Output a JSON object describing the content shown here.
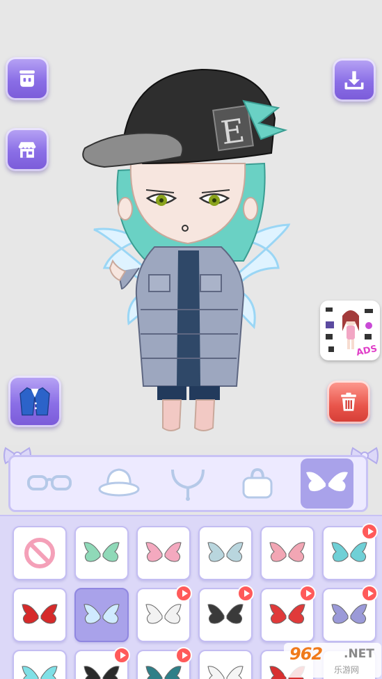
{
  "side_buttons": {
    "left": [
      {
        "name": "wardrobe-reset-button",
        "icon": "mannequin-icon"
      },
      {
        "name": "shop-button",
        "icon": "store-icon"
      },
      {
        "name": "outfit-button",
        "icon": "jacket-icon"
      }
    ],
    "right": [
      {
        "name": "download-button",
        "icon": "download-icon"
      },
      {
        "name": "delete-button",
        "icon": "trash-icon"
      }
    ]
  },
  "character": {
    "cap_letter": "E"
  },
  "ads_promo": {
    "label": "ADS"
  },
  "categories": [
    {
      "id": "glasses",
      "icon": "glasses-icon",
      "selected": false
    },
    {
      "id": "hat",
      "icon": "hat-icon",
      "selected": false
    },
    {
      "id": "necklace",
      "icon": "necklace-icon",
      "selected": false
    },
    {
      "id": "bag",
      "icon": "bag-icon",
      "selected": false
    },
    {
      "id": "wings",
      "icon": "wings-icon",
      "selected": true
    }
  ],
  "grid_items": [
    {
      "type": "none",
      "icon": "no-item-icon",
      "ad": false,
      "selected": false
    },
    {
      "type": "fairy-green",
      "icon": "wings-icon",
      "ad": false,
      "selected": false,
      "color": "#8fd9b8"
    },
    {
      "type": "pink",
      "icon": "wings-icon",
      "ad": false,
      "selected": false,
      "color": "#f4a9bf"
    },
    {
      "type": "clear",
      "icon": "wings-icon",
      "ad": false,
      "selected": false,
      "color": "#b9d6de"
    },
    {
      "type": "pink-small",
      "icon": "wings-icon",
      "ad": false,
      "selected": false,
      "color": "#f2a6b4"
    },
    {
      "type": "teal",
      "icon": "wings-icon",
      "ad": true,
      "selected": false,
      "color": "#6fd0d6"
    },
    {
      "type": "butterfly-red",
      "icon": "wings-icon",
      "ad": false,
      "selected": false,
      "color": "#d62a2a"
    },
    {
      "type": "angel-blue",
      "icon": "wings-icon",
      "ad": false,
      "selected": true,
      "color": "#cfeaff"
    },
    {
      "type": "white",
      "icon": "wings-icon",
      "ad": true,
      "selected": false,
      "color": "#f2f2f2"
    },
    {
      "type": "bat-black",
      "icon": "wings-icon",
      "ad": true,
      "selected": false,
      "color": "#3a3a3a"
    },
    {
      "type": "red-feather",
      "icon": "wings-icon",
      "ad": true,
      "selected": false,
      "color": "#e03a3a"
    },
    {
      "type": "lilac",
      "icon": "wings-icon",
      "ad": true,
      "selected": false,
      "color": "#9b9ad8"
    },
    {
      "type": "cyan",
      "icon": "wings-icon",
      "ad": false,
      "selected": false,
      "color": "#7fe0e6"
    },
    {
      "type": "dark-bat",
      "icon": "wings-icon",
      "ad": true,
      "selected": false,
      "color": "#2a2a2a"
    },
    {
      "type": "teal-dragon",
      "icon": "wings-icon",
      "ad": true,
      "selected": false,
      "color": "#2f7f88"
    },
    {
      "type": "white-large",
      "icon": "wings-icon",
      "ad": false,
      "selected": false,
      "color": "#f5f5f5"
    },
    {
      "type": "red-partial",
      "icon": "wings-icon",
      "ad": false,
      "selected": false,
      "color": "#d83030"
    },
    {
      "type": "blank",
      "icon": "wings-icon",
      "ad": false,
      "selected": false,
      "color": "#ffffff"
    }
  ],
  "watermark": {
    "big": "962",
    "net": ".NET",
    "small": "乐游网"
  },
  "colors": {
    "accent_purple": "#8a6ee6",
    "accent_red": "#e8544a",
    "panel_bg": "#dcd8f8",
    "selected_bg": "#a9a2ea"
  }
}
